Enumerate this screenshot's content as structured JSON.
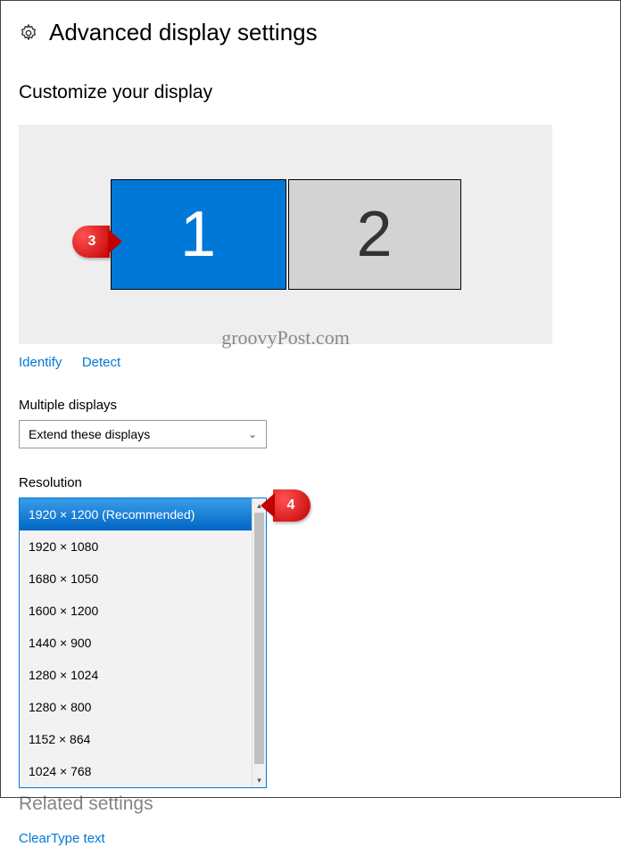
{
  "header": {
    "title": "Advanced display settings"
  },
  "customize": {
    "heading": "Customize your display",
    "monitor1": "1",
    "monitor2": "2",
    "watermark": "groovyPost.com",
    "identify_link": "Identify",
    "detect_link": "Detect"
  },
  "multiple_displays": {
    "label": "Multiple displays",
    "value": "Extend these displays"
  },
  "resolution": {
    "label": "Resolution",
    "options": [
      "1920 × 1200 (Recommended)",
      "1920 × 1080",
      "1680 × 1050",
      "1600 × 1200",
      "1440 × 900",
      "1280 × 1024",
      "1280 × 800",
      "1152 × 864",
      "1024 × 768"
    ],
    "selected_index": 0
  },
  "related": {
    "heading": "Related settings",
    "cleartype_link": "ClearType text"
  },
  "annotations": {
    "balloon3": "3",
    "balloon4": "4"
  }
}
